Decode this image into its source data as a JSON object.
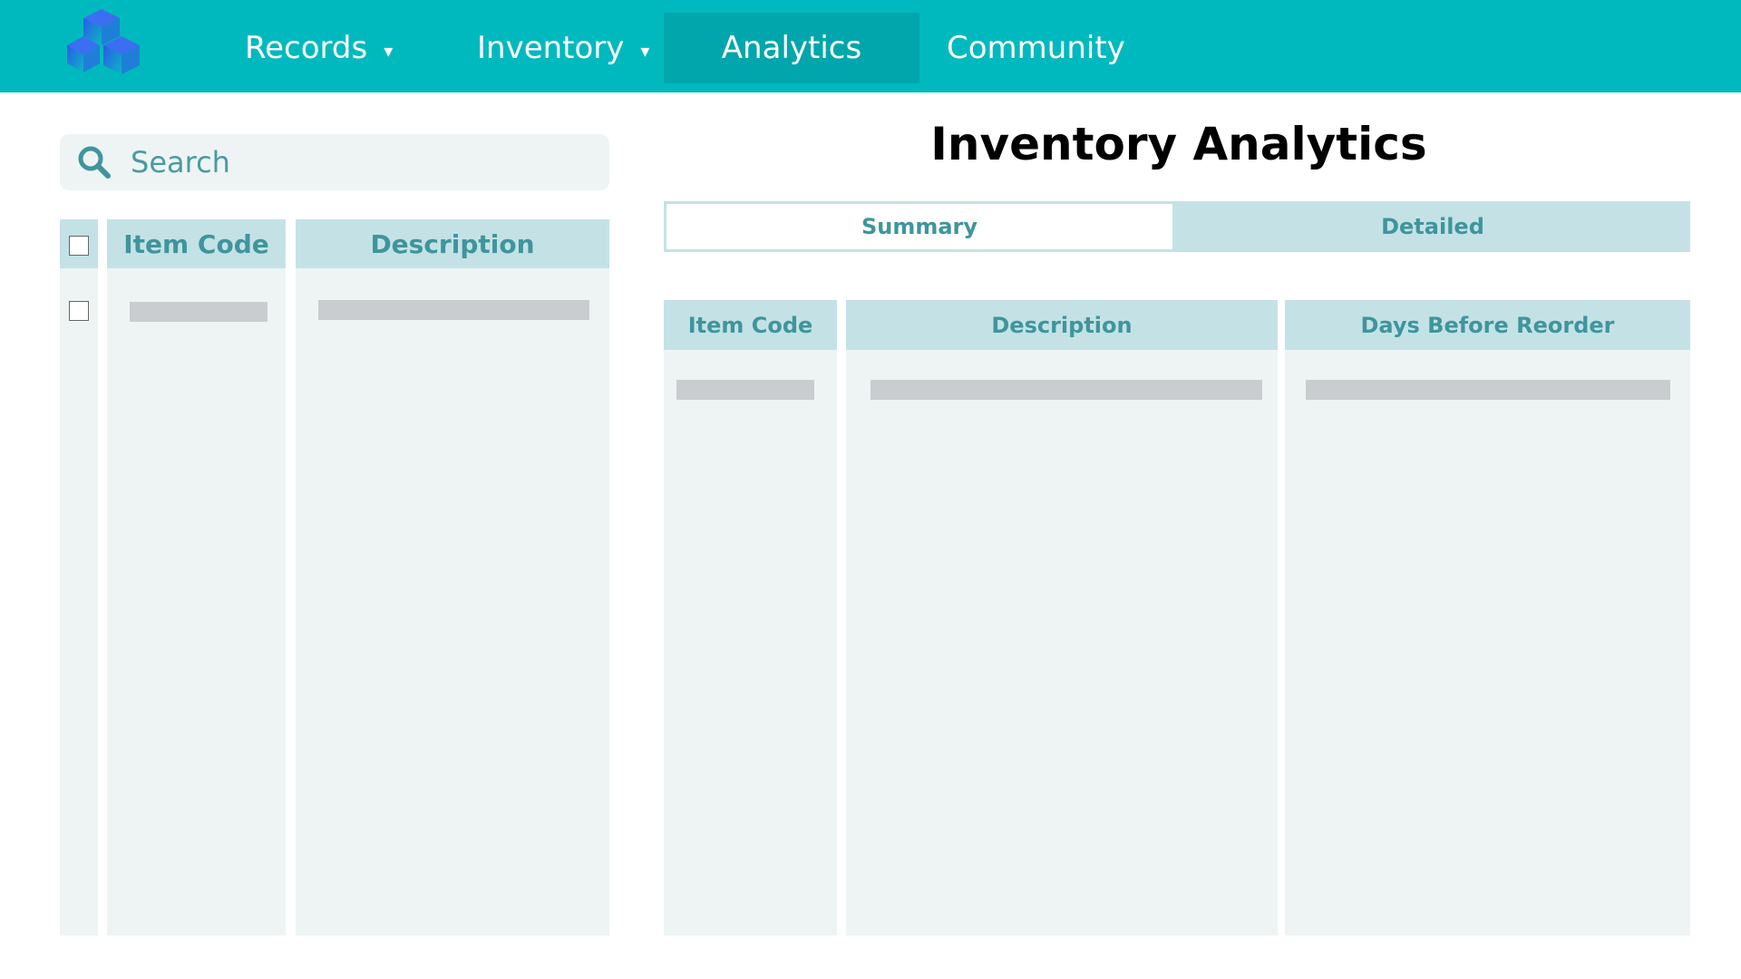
{
  "nav": {
    "items": [
      {
        "label": "Records",
        "caret": "▾"
      },
      {
        "label": "Inventory",
        "caret": "▾"
      },
      {
        "label": "Analytics"
      },
      {
        "label": "Community"
      }
    ]
  },
  "search": {
    "placeholder": "Search"
  },
  "left_table": {
    "headers": {
      "item_code": "Item Code",
      "description": "Description"
    }
  },
  "page": {
    "title": "Inventory Analytics"
  },
  "tabs": {
    "summary": "Summary",
    "detailed": "Detailed"
  },
  "right_table": {
    "headers": {
      "item_code": "Item Code",
      "description": "Description",
      "days": "Days Before Reorder"
    }
  }
}
